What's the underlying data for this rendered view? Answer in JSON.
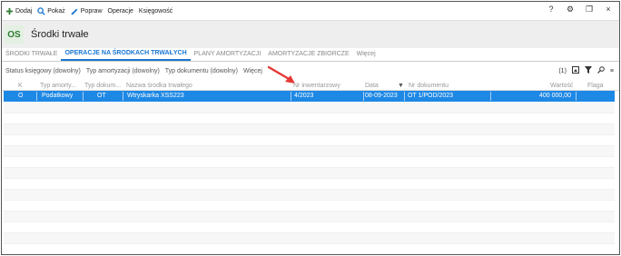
{
  "toolbar": {
    "add_label": "Dodaj",
    "show_label": "Pokaż",
    "edit_label": "Popraw",
    "operations_label": "Operacje",
    "accounting_label": "Księgowość",
    "help_icon": "?",
    "settings_icon": "gear-icon",
    "window_icon": "restore-icon",
    "close_icon": "×"
  },
  "header": {
    "badge": "OS",
    "title": "Środki trwałe"
  },
  "tabs": [
    {
      "label": "Środki trwałe"
    },
    {
      "label": "Operacje na środkach trwałych"
    },
    {
      "label": "Plany amortyzacji"
    },
    {
      "label": "Amortyzacje zbiorcze"
    },
    {
      "label": "Więcej"
    }
  ],
  "filters": {
    "status": "Status księgowy (dowolny)",
    "amort_type": "Typ amortyzacji (dowolny)",
    "doc_type": "Typ dokumentu (dowolny)",
    "more": "Więcej",
    "count": "(1)"
  },
  "grid": {
    "columns": {
      "k": "K",
      "amort_type": "Typ amorty...",
      "doc_type": "Typ dokum...",
      "asset_name": "Nazwa środka trwałego",
      "inventory_no": "Nr inwentarzowy",
      "date": "Data",
      "doc_no": "Nr dokumentu",
      "value": "Wartość",
      "flag": "Flaga"
    },
    "rows": [
      {
        "k": "O",
        "amort_type": "Podatkowy",
        "doc_type": "OT",
        "asset_name": "Wtryskarka XSS223",
        "inventory_no": "4/2023",
        "date": "08-09-2023",
        "doc_no": "OT 1/POD/2023",
        "value": "400 000,00",
        "flag": ""
      }
    ]
  },
  "colors": {
    "accent": "#1976d2",
    "selection": "#1e88e5",
    "arrow": "#e53935",
    "badge_text": "#2e7d32"
  }
}
